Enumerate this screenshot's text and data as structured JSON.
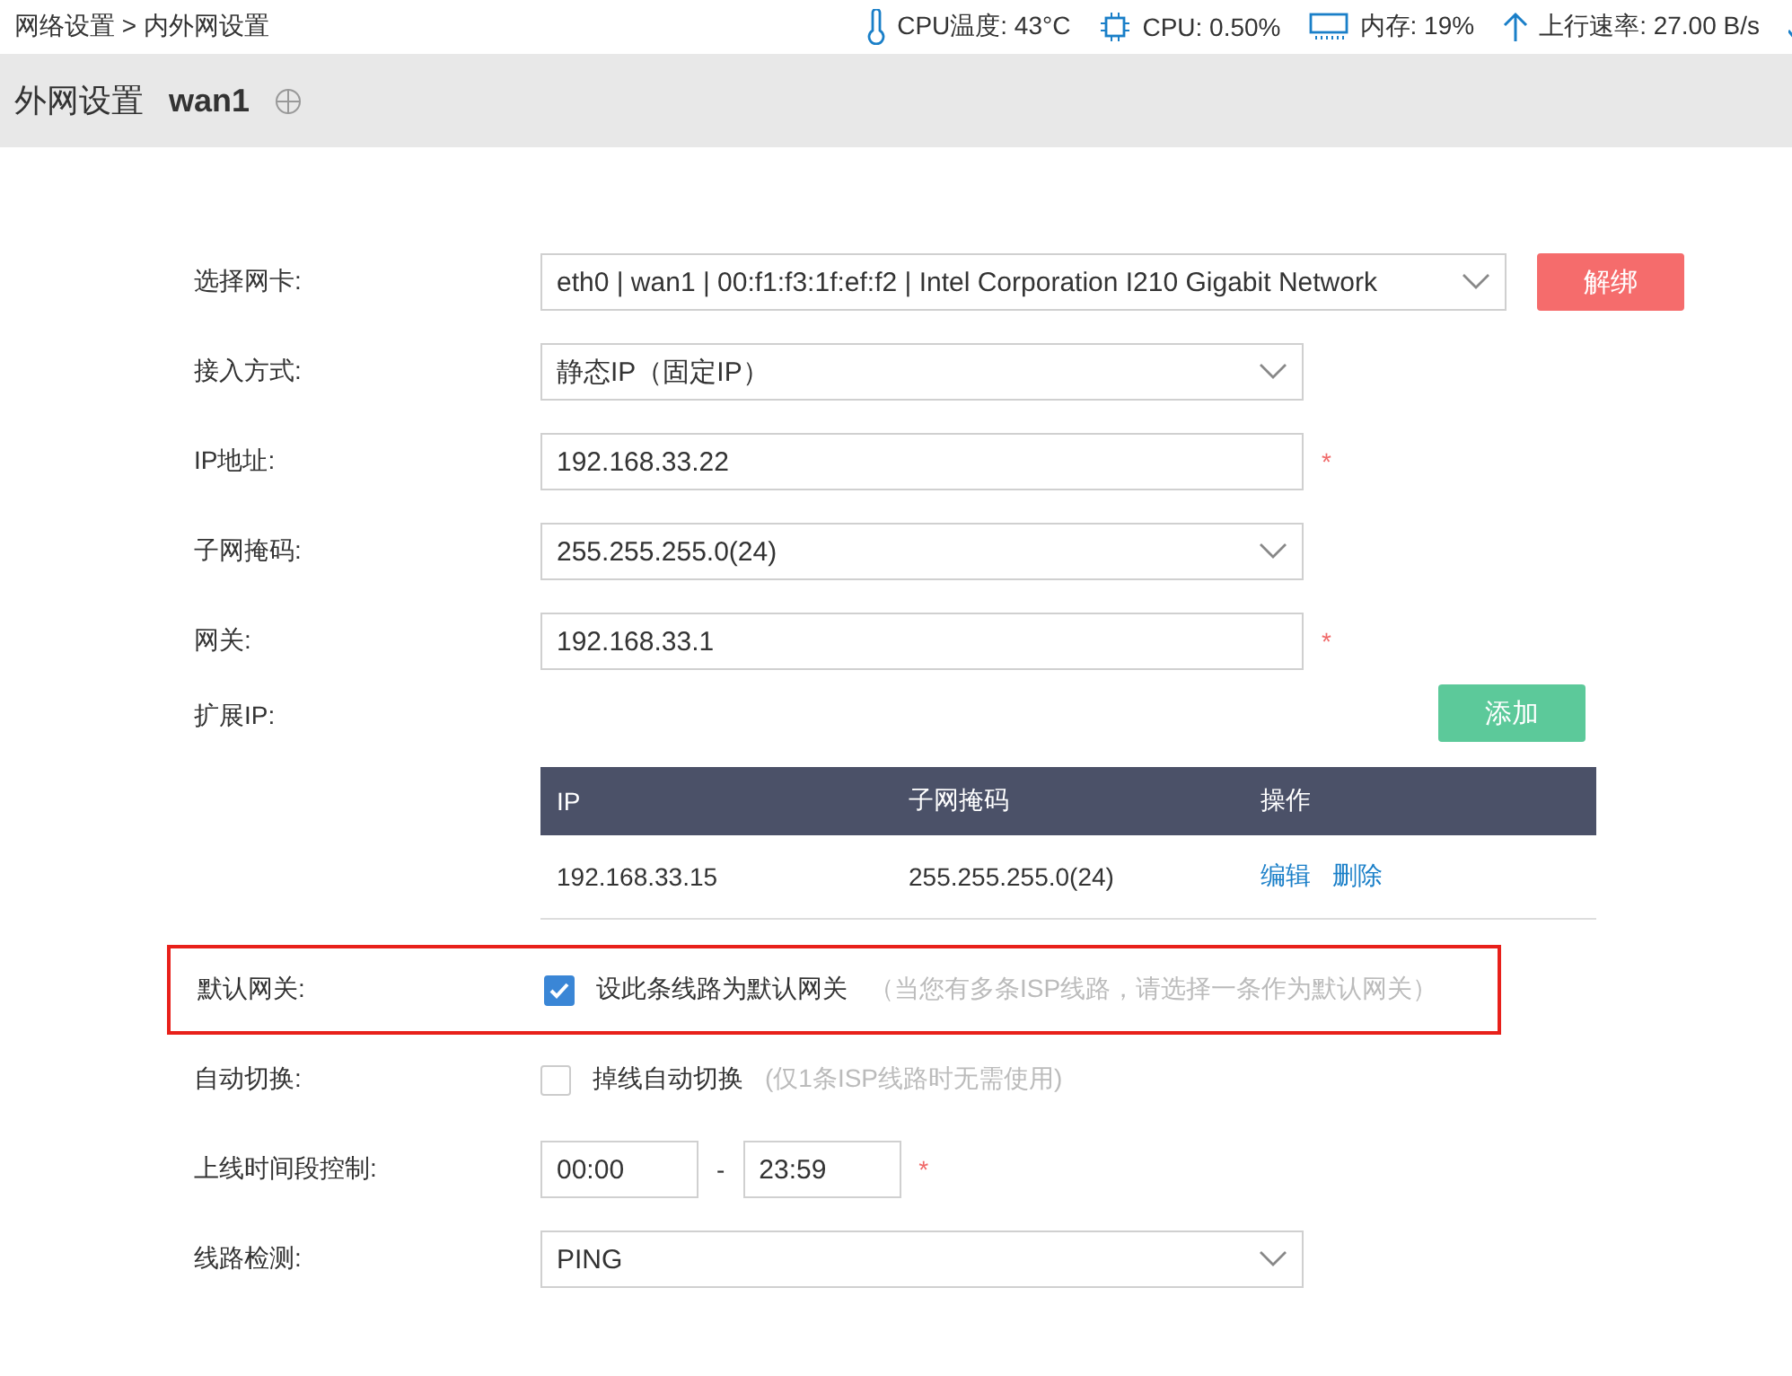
{
  "breadcrumb": "网络设置 > 内外网设置",
  "stats": [
    {
      "kind": "thermo",
      "text": "CPU温度: 43°C"
    },
    {
      "kind": "chip",
      "text": "CPU: 0.50%"
    },
    {
      "kind": "memory",
      "text": "内存: 19%"
    },
    {
      "kind": "up",
      "text": "上行速率: 27.00 B/s"
    },
    {
      "kind": "down"
    }
  ],
  "header": {
    "title": "外网设置",
    "name": "wan1"
  },
  "rows": [
    {
      "kind": "select",
      "label": "选择网卡:",
      "value": "eth0 | wan1 | 00:f1:f3:1f:ef:f2 | Intel Corporation I210 Gigabit Network",
      "button": "解绑"
    },
    {
      "kind": "select",
      "label": "接入方式:",
      "value": "静态IP（固定IP）"
    },
    {
      "kind": "input",
      "label": "IP地址:",
      "value": "192.168.33.22",
      "required_mark": "*"
    },
    {
      "kind": "select",
      "label": "子网掩码:",
      "value": "255.255.255.0(24)"
    },
    {
      "kind": "input",
      "label": "网关:",
      "value": "192.168.33.1",
      "required_mark": "*"
    },
    {
      "kind": "table",
      "label": "扩展IP:",
      "button": "添加",
      "columns": [
        "IP",
        "子网掩码",
        "操作"
      ],
      "table_rows": [
        {
          "ip": "192.168.33.15",
          "mask": "255.255.255.0(24)",
          "actions": [
            "编辑",
            "删除"
          ]
        }
      ]
    },
    {
      "kind": "checkbox",
      "label": "默认网关:",
      "text": "设此条线路为默认网关",
      "hint": "（当您有多条ISP线路，请选择一条作为默认网关）",
      "checked": true,
      "highlighted": true
    },
    {
      "kind": "checkbox",
      "label": "自动切换:",
      "text": "掉线自动切换",
      "hint": "(仅1条ISP线路时无需使用)",
      "checked": false,
      "highlighted": false
    },
    {
      "kind": "timerange",
      "label": "上线时间段控制:",
      "from": "00:00",
      "separator": "-",
      "to": "23:59",
      "required_mark": "*"
    },
    {
      "kind": "select",
      "label": "线路检测:",
      "value": "PING"
    }
  ]
}
